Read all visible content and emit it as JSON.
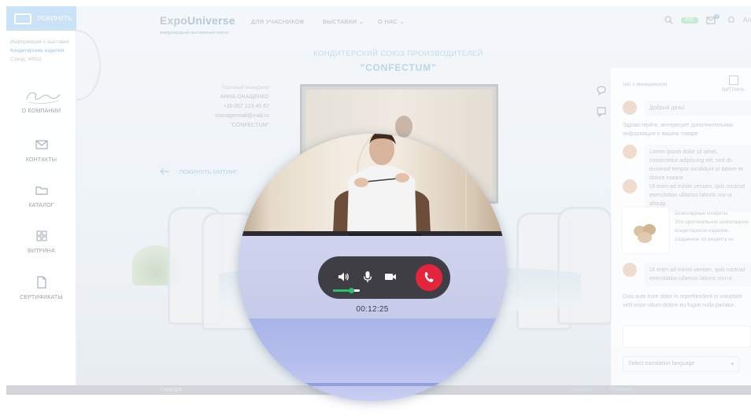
{
  "sidebar": {
    "leave_label": "ПОКИНУТЬ",
    "info_line1": "Информация о выставке",
    "info_link": "Кондитерские изделия",
    "stand_label": "Стенд:",
    "stand_value": "#0011",
    "items": [
      {
        "label": "О КОМПАНИИ",
        "icon": "company-logo-icon"
      },
      {
        "label": "КОНТАКТЫ",
        "icon": "envelope-icon"
      },
      {
        "label": "КАТАЛОГ",
        "icon": "folder-icon"
      },
      {
        "label": "ВИТРИНА",
        "icon": "grid-icon"
      },
      {
        "label": "СЕРТИФИКАТЫ",
        "icon": "document-icon"
      }
    ]
  },
  "header": {
    "logo_part1": "Expo",
    "logo_part2": "Universe",
    "logo_sub": "международный выставочный портал",
    "nav": [
      {
        "label": "ДЛЯ УЧАСНИКОВ"
      },
      {
        "label": "ВЫСТАВКИ"
      },
      {
        "label": "О НАС"
      }
    ],
    "badge": "РУС",
    "mail_count": "3",
    "user_short": "Ал"
  },
  "company": {
    "subtitle": "КОНДИТЕРСКИЙ СОЮЗ ПРОИЗВОДИТЕЛЕЙ",
    "name": "\"CONFECTUM\""
  },
  "contact": {
    "label": "Торговый менеджер",
    "name": "АННА ОНАЩЕНКО",
    "phone": "+38 067 123 45 67",
    "email": "managermail@mail.ru",
    "company": "\"CONFECTUM\""
  },
  "leave_meeting": "ПОКИНУТЬ МИТИНГ",
  "chat": {
    "header": "Чат с менеджером",
    "showcase_label": "ВИТРИНА",
    "messages": [
      {
        "text": "Добрый день!"
      },
      {
        "text": "Здравствуйте, интересует дополнительная информация о вашем товаре"
      },
      {
        "text": "Lorem ipsum dolor sit amet, consectetur adipiscing elit, sed do eiusmod tempor incididunt ut labore et dolore magna"
      },
      {
        "text": "Ut enim ad minim veniam, quis nostrud exercitation ullamco laboris nisi ut aliquip"
      },
      {
        "text": "Ut enim ad minim veniam, quis nostrud exercitation ullamco laboris nisi ut"
      },
      {
        "text": "Duis aute irure dolor in reprehenderit in voluptate velit esse cillum dolore eu fugiat nulla pariatur."
      }
    ],
    "product": {
      "title": "Шоколадные конфеты",
      "desc": "Это оригинальное шоколадное кондитерское изделие, созданное по рецепту из"
    },
    "language_placeholder": "Select translation language"
  },
  "call": {
    "timer": "00:12:25",
    "volume_level": 0.7,
    "accent": "#28c06a",
    "hangup_color": "#e4253c"
  },
  "footer": {
    "copyright": "Copyright",
    "links": "Instagram Facebook"
  }
}
